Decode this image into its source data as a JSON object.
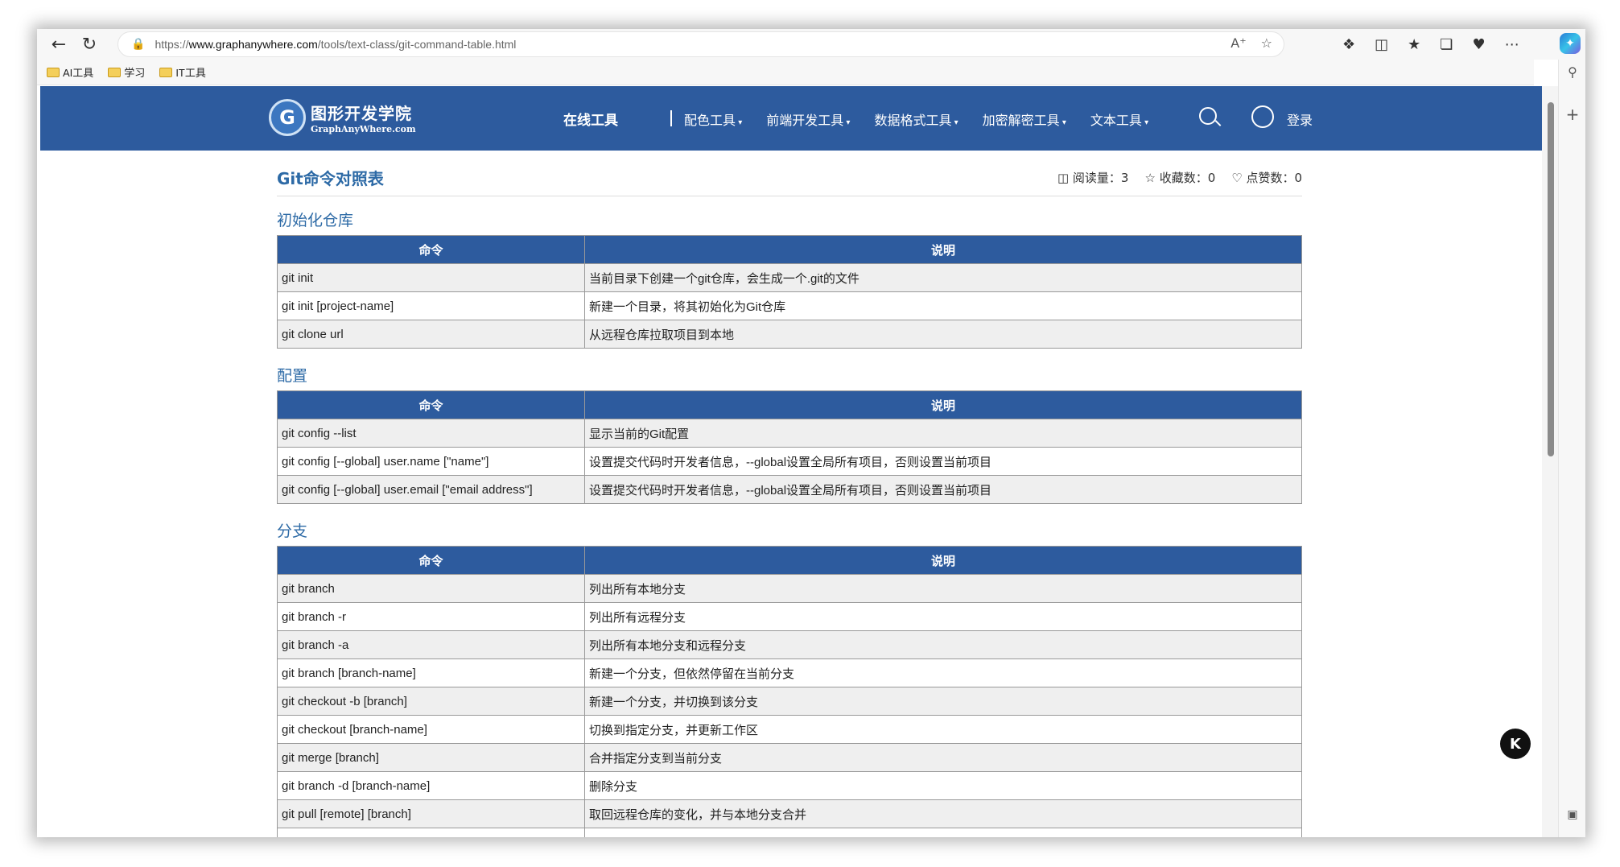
{
  "browser": {
    "url_prefix": "https://",
    "url_domain": "www.graphanywhere.com",
    "url_path": "/tools/text-class/git-command-table.html",
    "bookmarks": [
      "AI工具",
      "学习",
      "IT工具"
    ]
  },
  "site": {
    "logo_title": "图形开发学院",
    "logo_subtitle": "GraphAnyWhere.com",
    "nav_main": "在线工具",
    "nav_items": [
      "配色工具",
      "前端开发工具",
      "数据格式工具",
      "加密解密工具",
      "文本工具"
    ],
    "login": "登录"
  },
  "article": {
    "title": "Git命令对照表",
    "reads": "阅读量：3",
    "favorites": "收藏数：0",
    "likes": "点赞数：0"
  },
  "table_headers": {
    "command": "命令",
    "description": "说明"
  },
  "sections": [
    {
      "title": "初始化仓库",
      "rows": [
        [
          "git init",
          "当前目录下创建一个git仓库，会生成一个.git的文件"
        ],
        [
          "git init [project-name]",
          "新建一个目录，将其初始化为Git仓库"
        ],
        [
          "git clone url",
          "从远程仓库拉取项目到本地"
        ]
      ]
    },
    {
      "title": "配置",
      "rows": [
        [
          "git config --list",
          "显示当前的Git配置"
        ],
        [
          "git config [--global] user.name [\"name\"]",
          "设置提交代码时开发者信息，--global设置全局所有项目，否则设置当前项目"
        ],
        [
          "git config [--global] user.email [\"email address\"]",
          "设置提交代码时开发者信息，--global设置全局所有项目，否则设置当前项目"
        ]
      ]
    },
    {
      "title": "分支",
      "rows": [
        [
          "git branch",
          "列出所有本地分支"
        ],
        [
          "git branch -r",
          "列出所有远程分支"
        ],
        [
          "git branch -a",
          "列出所有本地分支和远程分支"
        ],
        [
          "git branch [branch-name]",
          "新建一个分支，但依然停留在当前分支"
        ],
        [
          "git checkout -b [branch]",
          "新建一个分支，并切换到该分支"
        ],
        [
          "git checkout [branch-name]",
          "切换到指定分支，并更新工作区"
        ],
        [
          "git merge [branch]",
          "合并指定分支到当前分支"
        ],
        [
          "git branch -d [branch-name]",
          "删除分支"
        ],
        [
          "git pull [remote] [branch]",
          "取回远程仓库的变化，并与本地分支合并"
        ]
      ]
    }
  ]
}
